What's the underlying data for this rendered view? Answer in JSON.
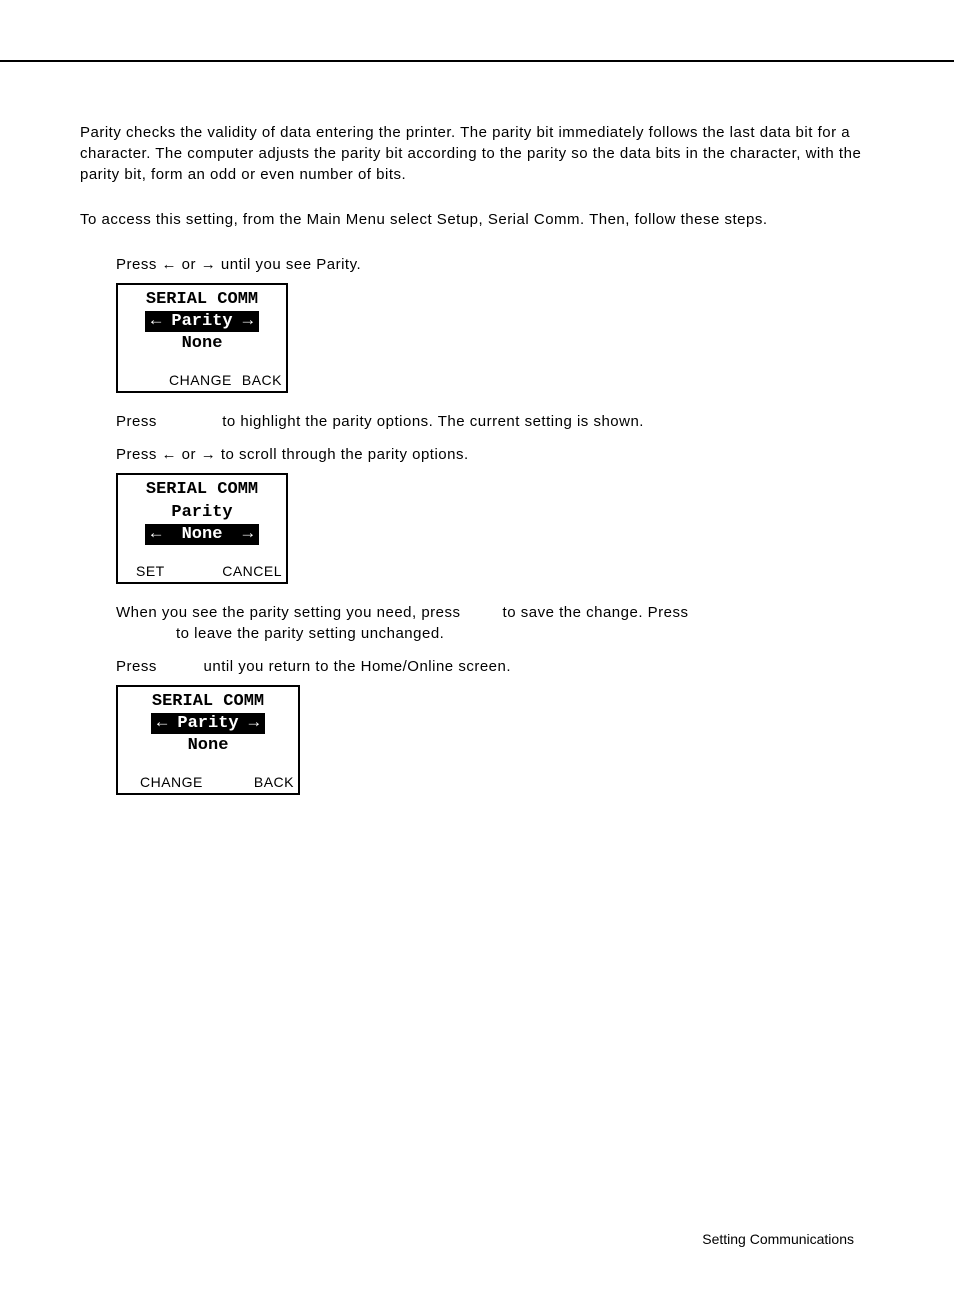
{
  "paragraphs": {
    "p1": "Parity checks the validity of data entering the printer. The parity bit immediately follows the last data bit for a character. The computer adjusts the parity bit according to the parity so the data bits in the character, with the parity bit, form an odd or even number of bits.",
    "p2": "To access this setting, from the Main Menu select Setup, Serial Comm.  Then, follow these steps."
  },
  "steps": {
    "s1a": "Press ",
    "s1b": " or ",
    "s1c": " until you see Parity.",
    "s2a": "Press ",
    "s2b": " to highlight the parity options. The current setting is shown.",
    "s3a": "Press ",
    "s3b": " or ",
    "s3c": " to scroll through the parity options.",
    "s4a": "When you see the parity setting you need, press ",
    "s4b": " to save the change.  Press",
    "s4c": " to leave the parity setting unchanged.",
    "s5a": "Press ",
    "s5b": " until you return to the Home/Online screen."
  },
  "arrows": {
    "left": "←",
    "right": "→"
  },
  "lcd1": {
    "title": "SERIAL COMM",
    "hl": "← Parity →",
    "value": "None",
    "softLeft": "CHANGE",
    "softRight": "BACK"
  },
  "lcd2": {
    "title": "SERIAL COMM",
    "sub": "Parity",
    "hl": "←  None  →",
    "softLeft": "SET",
    "softRight": "CANCEL"
  },
  "lcd3": {
    "title": "SERIAL COMM",
    "hl": "← Parity →",
    "value": "None",
    "softLeft": "CHANGE",
    "softRight": "BACK"
  },
  "footer": "Setting Communications"
}
